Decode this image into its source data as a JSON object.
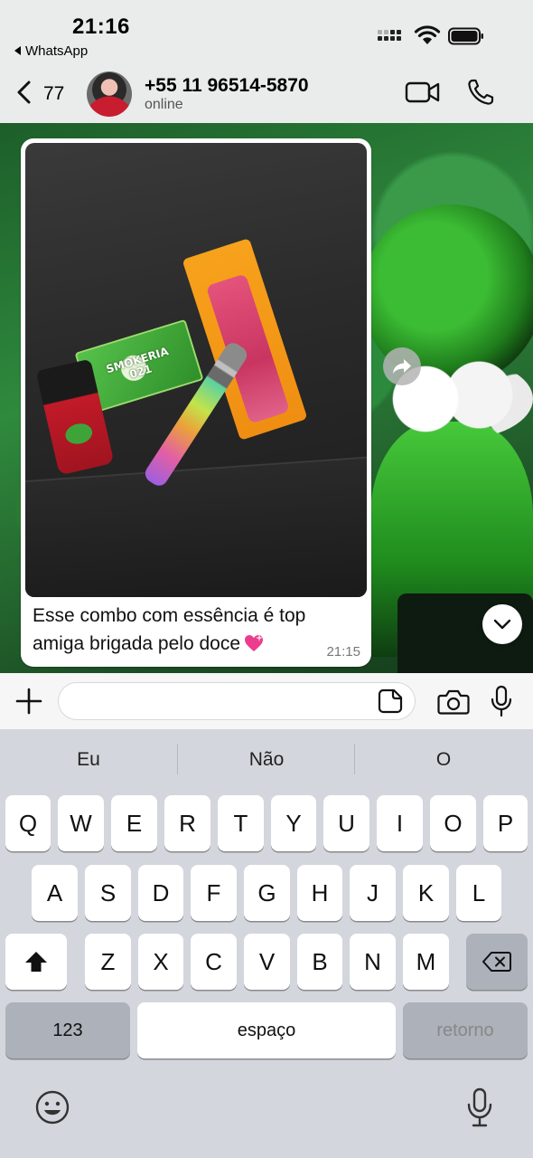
{
  "status_bar": {
    "time": "21:16",
    "back_app": "WhatsApp"
  },
  "header": {
    "back_count": "77",
    "contact_name": "+55 11 96514-5870",
    "contact_status": "online"
  },
  "message": {
    "text_line1": "Esse combo com essência é top",
    "text_line2": "amiga brigada pelo doce",
    "time": "21:15",
    "photo_card_text_1": "SMOKERIA",
    "photo_card_text_2": "021"
  },
  "input": {
    "placeholder": ""
  },
  "keyboard": {
    "suggestions": [
      "Eu",
      "Não",
      "O"
    ],
    "row1": [
      "Q",
      "W",
      "E",
      "R",
      "T",
      "Y",
      "U",
      "I",
      "O",
      "P"
    ],
    "row2": [
      "A",
      "S",
      "D",
      "F",
      "G",
      "H",
      "J",
      "K",
      "L"
    ],
    "row3": [
      "Z",
      "X",
      "C",
      "V",
      "B",
      "N",
      "M"
    ],
    "numbers_label": "123",
    "space_label": "espaço",
    "return_label": "retorno"
  },
  "colors": {
    "accent_green": "#2f8a3d",
    "bubble": "#ffffff",
    "keyboard_bg": "#d3d6dc"
  }
}
